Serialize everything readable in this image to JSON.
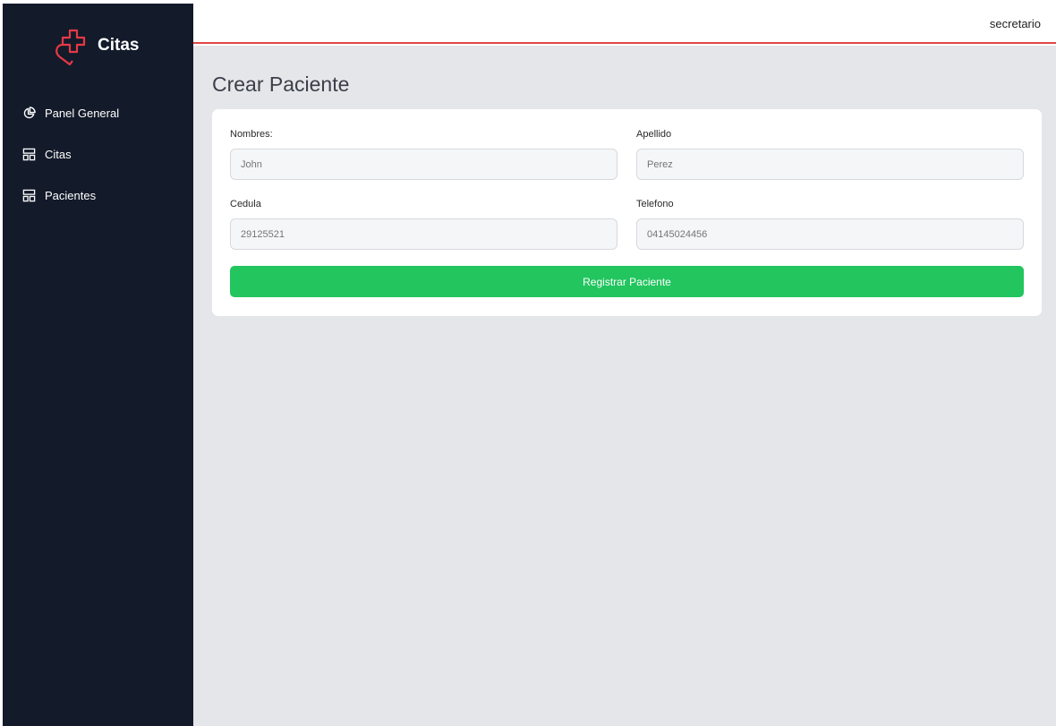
{
  "brand": {
    "name": "Citas",
    "logo_icon": "heart-cross-icon",
    "accent_color": "#e63946"
  },
  "sidebar": {
    "items": [
      {
        "label": "Panel General",
        "icon": "pie-chart-icon"
      },
      {
        "label": "Citas",
        "icon": "layout-icon"
      },
      {
        "label": "Pacientes",
        "icon": "layout-icon"
      }
    ]
  },
  "header": {
    "username": "secretario",
    "border_color": "#e04848"
  },
  "page": {
    "title": "Crear Paciente"
  },
  "form": {
    "nombres": {
      "label": "Nombres:",
      "placeholder": "John"
    },
    "apellido": {
      "label": "Apellido",
      "placeholder": "Perez"
    },
    "cedula": {
      "label": "Cedula",
      "placeholder": "29125521"
    },
    "telefono": {
      "label": "Telefono",
      "placeholder": "04145024456"
    },
    "submit_label": "Registrar Paciente",
    "submit_color": "#22c55e"
  }
}
